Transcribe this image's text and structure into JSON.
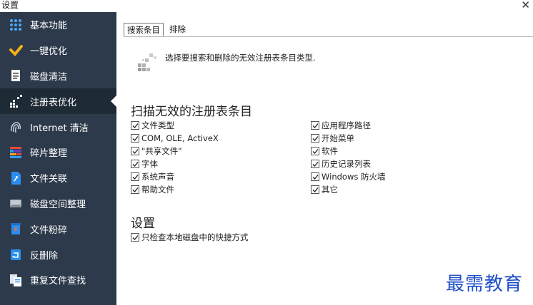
{
  "window": {
    "title": "设置",
    "close_label": "✕"
  },
  "sidebar": {
    "items": [
      {
        "label": "基本功能",
        "icon": "grid-dots-icon",
        "active": false
      },
      {
        "label": "一键优化",
        "icon": "broom-icon",
        "active": false
      },
      {
        "label": "磁盘清洁",
        "icon": "disk-file-icon",
        "active": false
      },
      {
        "label": "注册表优化",
        "icon": "registry-cubes-icon",
        "active": true
      },
      {
        "label": "Internet 清洁",
        "icon": "fingerprint-icon",
        "active": false
      },
      {
        "label": "碎片整理",
        "icon": "defrag-blocks-icon",
        "active": false
      },
      {
        "label": "文件关联",
        "icon": "file-link-icon",
        "active": false
      },
      {
        "label": "磁盘空间整理",
        "icon": "drive-icon",
        "active": false
      },
      {
        "label": "文件粉碎",
        "icon": "shredder-icon",
        "active": false
      },
      {
        "label": "反删除",
        "icon": "undelete-icon",
        "active": false
      },
      {
        "label": "重复文件查找",
        "icon": "duplicate-files-icon",
        "active": false
      }
    ],
    "colors": {
      "background": "#2d3a4b",
      "active": "#1f2a37"
    }
  },
  "tabs": [
    {
      "label": "搜索条目",
      "active": true
    },
    {
      "label": "排除",
      "active": false
    }
  ],
  "intro_text": "选择要搜索和删除的无效注册表条目类型.",
  "scan_section": {
    "title": "扫描无效的注册表条目",
    "left": [
      {
        "label": "文件类型",
        "checked": true
      },
      {
        "label": "COM, OLE, ActiveX",
        "checked": true
      },
      {
        "label": "\"共享文件\"",
        "checked": true
      },
      {
        "label": "字体",
        "checked": true
      },
      {
        "label": "系统声音",
        "checked": true
      },
      {
        "label": "帮助文件",
        "checked": true
      }
    ],
    "right": [
      {
        "label": "应用程序路径",
        "checked": true
      },
      {
        "label": "开始菜单",
        "checked": true
      },
      {
        "label": "软件",
        "checked": true
      },
      {
        "label": "历史记录列表",
        "checked": true
      },
      {
        "label": "Windows 防火墙",
        "checked": true
      },
      {
        "label": "其它",
        "checked": true
      }
    ]
  },
  "settings_section": {
    "title": "设置",
    "items": [
      {
        "label": "只检查本地磁盘中的快捷方式",
        "checked": true
      }
    ]
  },
  "watermark": "最需教育"
}
